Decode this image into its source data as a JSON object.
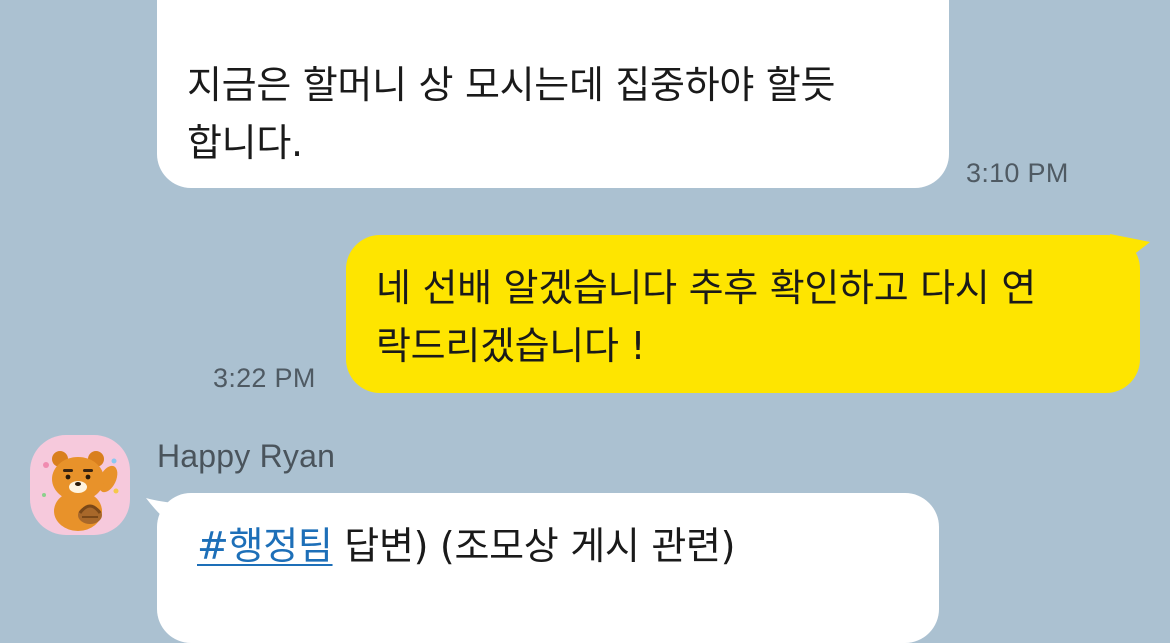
{
  "messages": [
    {
      "type": "received",
      "lines": [
        "지금은 할머니 상 모시는데 집중하야 할듯",
        "합니다."
      ],
      "time": "3:10 PM"
    },
    {
      "type": "sent",
      "lines": [
        "네 선배 알겠습니다 추후 확인하고 다시 연",
        "락드리겠습니다 !"
      ],
      "time": "3:22 PM"
    },
    {
      "type": "received",
      "sender": "Happy Ryan",
      "avatar": "ryan-character-avatar",
      "hashtag": "#행정팀",
      "text": " 답변) (조모상 게시 관련)"
    }
  ],
  "colors": {
    "background": "#abc1d1",
    "sent_bubble": "#fee500",
    "received_bubble": "#ffffff",
    "hashtag_link": "#1d6fb8",
    "avatar_background": "#f6c9dc"
  }
}
